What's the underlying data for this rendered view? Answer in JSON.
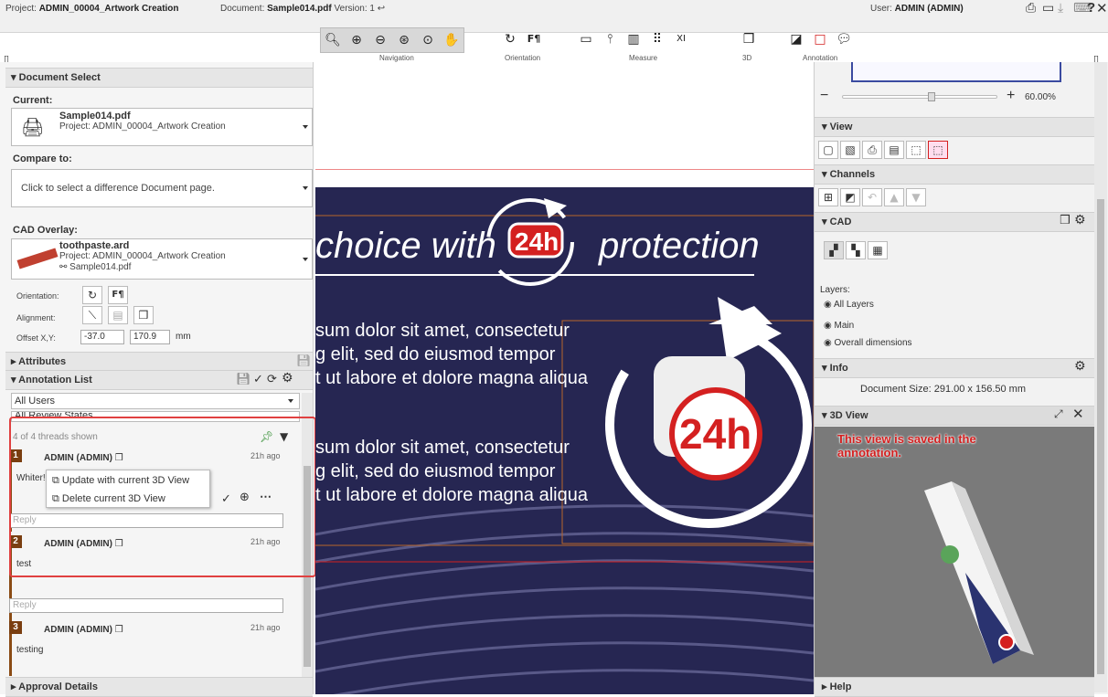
{
  "topbar": {
    "project_prefix": "Project: ",
    "project": "ADMIN_00004_Artwork Creation",
    "doc_prefix": "Document: ",
    "document": "Sample014.pdf",
    "version": " Version: 1",
    "user_prefix": "User: ",
    "user": "ADMIN (ADMIN)"
  },
  "toolbar": {
    "groups": [
      {
        "label": "Navigation"
      },
      {
        "label": "Orientation"
      },
      {
        "label": "Measure"
      },
      {
        "label": "3D"
      },
      {
        "label": "Annotation"
      }
    ]
  },
  "left": {
    "document_select": "Document Select",
    "current_label": "Current:",
    "current_file": "Sample014.pdf",
    "current_project": "Project: ADMIN_00004_Artwork Creation",
    "compare_label": "Compare to:",
    "compare_placeholder": "Click to select a difference Document page.",
    "cad_label": "CAD Overlay:",
    "cad_file": "toothpaste.ard",
    "cad_project": "Project: ADMIN_00004_Artwork Creation",
    "cad_link": "Sample014.pdf",
    "orientation_label": "Orientation:",
    "alignment_label": "Alignment:",
    "offset_label": "Offset X,Y:",
    "offset_x": "-37.0",
    "offset_y": "170.9",
    "offset_unit": "mm",
    "attributes": "Attributes",
    "annotation_list": "Annotation List",
    "users_filter": "All Users",
    "states_filter": "All Review States",
    "threads_shown": "4 of 4 threads shown",
    "threads": [
      {
        "num": "1",
        "author": "ADMIN (ADMIN)",
        "time": "21h ago",
        "text": "Whiter!"
      },
      {
        "num": "2",
        "author": "ADMIN (ADMIN)",
        "time": "21h ago",
        "text": "test"
      },
      {
        "num": "3",
        "author": "ADMIN (ADMIN)",
        "time": "21h ago",
        "text": "testing"
      }
    ],
    "menu_update": "Update with current 3D View",
    "menu_delete": "Delete current 3D View",
    "reply_placeholder": "Reply",
    "approval": "Approval Details"
  },
  "artwork": {
    "headline_left": "choice with",
    "badge": "24h",
    "headline_right": "protection",
    "para1": [
      "sum dolor sit amet, consectetur",
      "g elit, sed do eiusmod tempor",
      "t ut labore et dolore magna aliqua"
    ],
    "para2": [
      "sum dolor sit amet, consectetur",
      "g elit, sed do eiusmod tempor",
      "t ut labore et dolore magna aliqua"
    ],
    "big_badge": "24h"
  },
  "right": {
    "zoom": "60.00%",
    "view": "View",
    "channels": "Channels",
    "cad": "CAD",
    "layers_label": "Layers:",
    "layers": [
      "All Layers",
      "Main",
      "Overall dimensions"
    ],
    "info": "Info",
    "doc_size_label": "Document Size:",
    "doc_size": "291.00 x 156.50 mm",
    "view3d": "3D View",
    "note": "This view is saved in the annotation.",
    "help": "Help"
  },
  "colors": {
    "accent": "#d42020",
    "brown": "#7a3e10",
    "navy": "#262652"
  }
}
